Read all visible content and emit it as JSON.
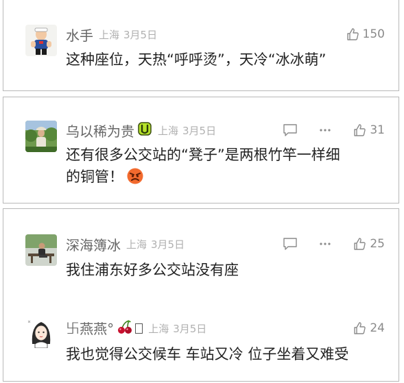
{
  "comments": [
    {
      "username": "水手",
      "location": "上海",
      "date": "3月5日",
      "likes": "150",
      "text": "这种座位，天热“呼呼烫”，天冷“冰冰萌”",
      "avatar_icon": "sailor-cartoon-avatar"
    },
    {
      "username": "乌以稀为贵",
      "location": "上海",
      "date": "3月5日",
      "likes": "31",
      "text_line1": "还有很多公交站的“凳子”是两根竹竿一样细",
      "text_line2": "的铜管！",
      "avatar_icon": "outdoor-photo-avatar",
      "badge_icon": "green-bracket-badge-icon",
      "emoji_icon": "angry-face-emoji-icon"
    },
    {
      "username": "深海簿冰",
      "location": "上海",
      "date": "3月5日",
      "likes": "25",
      "text": "我住浦东好多公交站没有座",
      "avatar_icon": "person-on-bench-avatar"
    },
    {
      "username": "࿕燕燕°",
      "location": "上海",
      "date": "3月5日",
      "likes": "24",
      "text": "我也觉得公交候车 车站又冷 位子坐着又难受",
      "avatar_icon": "cartoon-girl-avatar",
      "badge_icon": "cherry-emoji-icon"
    }
  ],
  "icons": {
    "reply": "reply-icon",
    "more": "more-icon",
    "like": "thumbs-up-icon"
  },
  "colors": {
    "username": "#666666",
    "meta": "#b0b0b0",
    "text": "#222222",
    "border": "#b8b8b8"
  }
}
